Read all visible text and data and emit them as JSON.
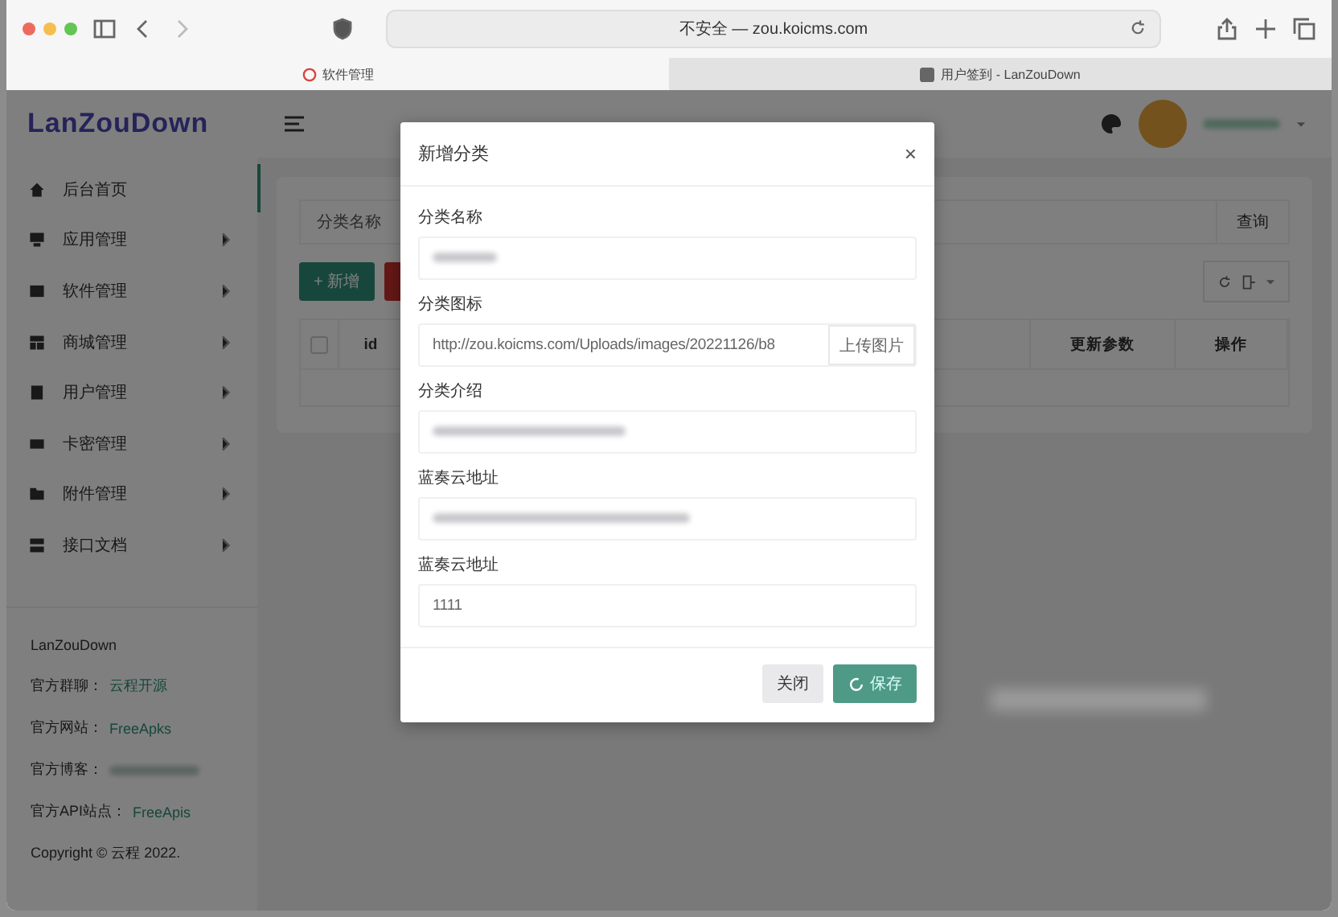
{
  "browser": {
    "address": "不安全 — zou.koicms.com",
    "tabs": [
      {
        "title": "软件管理",
        "selected": true
      },
      {
        "title": "用户签到 - LanZouDown",
        "selected": false
      }
    ]
  },
  "app": {
    "logo": "LanZouDown",
    "sidebar": {
      "items": [
        {
          "label": "后台首页",
          "expandable": false,
          "selected": true
        },
        {
          "label": "应用管理",
          "expandable": true,
          "selected": false
        },
        {
          "label": "软件管理",
          "expandable": true,
          "selected": false
        },
        {
          "label": "商城管理",
          "expandable": true,
          "selected": false
        },
        {
          "label": "用户管理",
          "expandable": true,
          "selected": false
        },
        {
          "label": "卡密管理",
          "expandable": true,
          "selected": false
        },
        {
          "label": "附件管理",
          "expandable": true,
          "selected": false
        },
        {
          "label": "接口文档",
          "expandable": true,
          "selected": false
        }
      ],
      "footer": [
        {
          "label": "LanZouDown"
        },
        {
          "label": "官方群聊：",
          "link": "云程开源"
        },
        {
          "label": "官方网站：",
          "link": "FreeApks"
        },
        {
          "label": "官方博客：",
          "link_redacted": true
        },
        {
          "label": "官方API站点：",
          "link": "FreeApis"
        },
        {
          "label": "Copyright © 云程 2022."
        }
      ]
    },
    "search": {
      "label": "分类名称",
      "button": "查询"
    },
    "add_button": "+ 新增",
    "table": {
      "select_all": {
        "checked": false
      },
      "columns": [
        "id",
        "更新参数",
        "操作"
      ]
    }
  },
  "dialog": {
    "title": "新增分类",
    "close": "×",
    "fields": [
      {
        "label": "分类名称",
        "redacted": true
      },
      {
        "label": "分类图标",
        "value": "http://zou.koicms.com/Uploads/images/20221126/b8",
        "button": "上传图片"
      },
      {
        "label": "分类介绍",
        "redacted": true
      },
      {
        "label": "蓝奏云地址",
        "redacted": true
      },
      {
        "label": "蓝奏云地址",
        "value": "1111"
      }
    ],
    "buttons": [
      {
        "label": "关闭",
        "kind": "secondary",
        "loading": false
      },
      {
        "label": "保存",
        "kind": "primary",
        "loading": true
      }
    ]
  }
}
